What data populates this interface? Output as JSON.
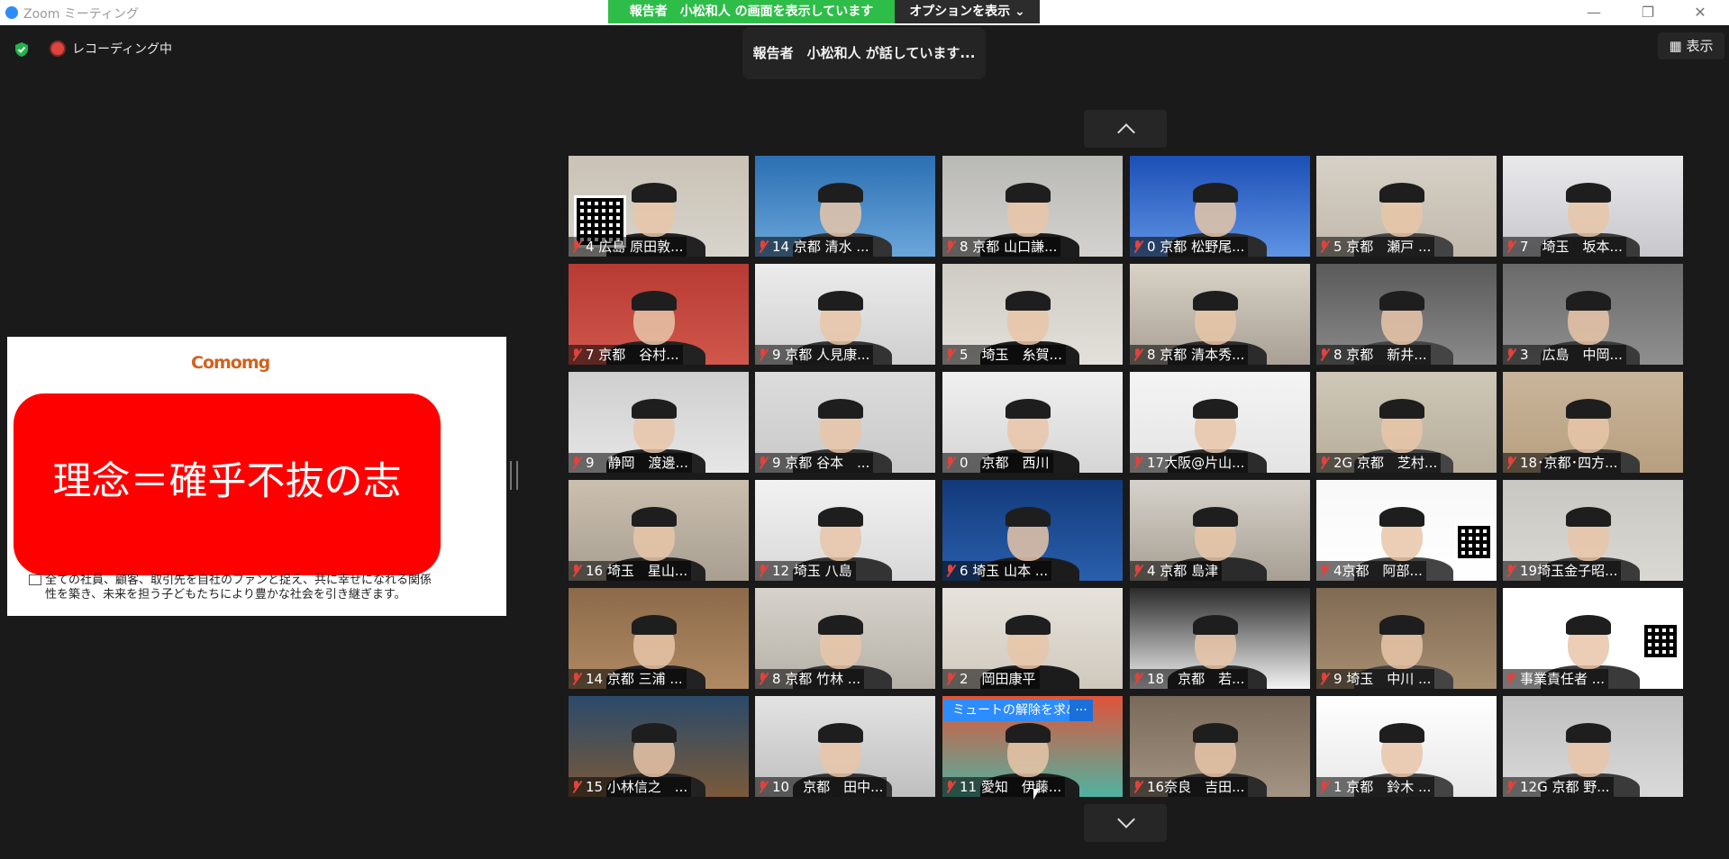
{
  "window": {
    "title": "Zoom ミーティング"
  },
  "share_banner": {
    "text": "報告者　小松和人 の画面を表示しています",
    "options": "オプションを表示 ⌄"
  },
  "recording": {
    "label": "レコーディング中"
  },
  "speaking": {
    "text": "報告者　小松和人 が話しています..."
  },
  "view_button": {
    "label": "▦ 表示"
  },
  "slide": {
    "logo": "Comomg",
    "headline": "理念＝確乎不抜の志",
    "body": "全ての社員、顧客、取引先を自社のファンと捉え、共に幸せになれる関係性を築き、未来を担う子どもたちにより豊かな社会を引き継ぎます。"
  },
  "unmute_request": {
    "label": "ミュートの解除を求める",
    "more": "···"
  },
  "colors": {
    "share_green": "#2fbd4a",
    "mute_red": "#e0433c",
    "zoom_blue": "#2d8cff",
    "bg": "#1a1a1a"
  },
  "icons": [
    "shield-icon",
    "record-icon",
    "grid-icon",
    "chevron-up-icon",
    "chevron-down-icon",
    "mic-muted-icon",
    "cursor-icon"
  ],
  "participants": [
    "4 広島 原田敦...",
    "14 京都 清水 ...",
    "8 京都 山口謙...",
    "0 京都 松野尾...",
    "5 京都　瀬戸 ...",
    "7　埼玉　坂本...",
    "7 京都　谷村...",
    "9 京都 人見康...",
    "5　埼玉　糸賀...",
    "8 京都 清本秀...",
    "8 京都　新井...",
    "3　広島　中岡...",
    "9　静岡　渡邊...",
    "9 京都 谷本　...",
    "0　京都　西川",
    "17大阪@片山...",
    "2G 京都　芝村...",
    "18･京都･四方...",
    "16 埼玉　星山...",
    "12 埼玉 八島",
    "6 埼玉 山本 ...",
    "4 京都 島津",
    "4京都　阿部...",
    "19埼玉金子昭...",
    "14 京都 三浦 ...",
    "8 京都 竹林 ...",
    "2　岡田康平",
    "18　京都　若...",
    "9 埼玉　中川 ...",
    "事業責任者 ...",
    "15 小林信之　...",
    "10　京都　田中...",
    "11 愛知　伊藤...",
    "16奈良　吉田...",
    "1 京都　鈴木 ...",
    "12G 京都 野..."
  ]
}
